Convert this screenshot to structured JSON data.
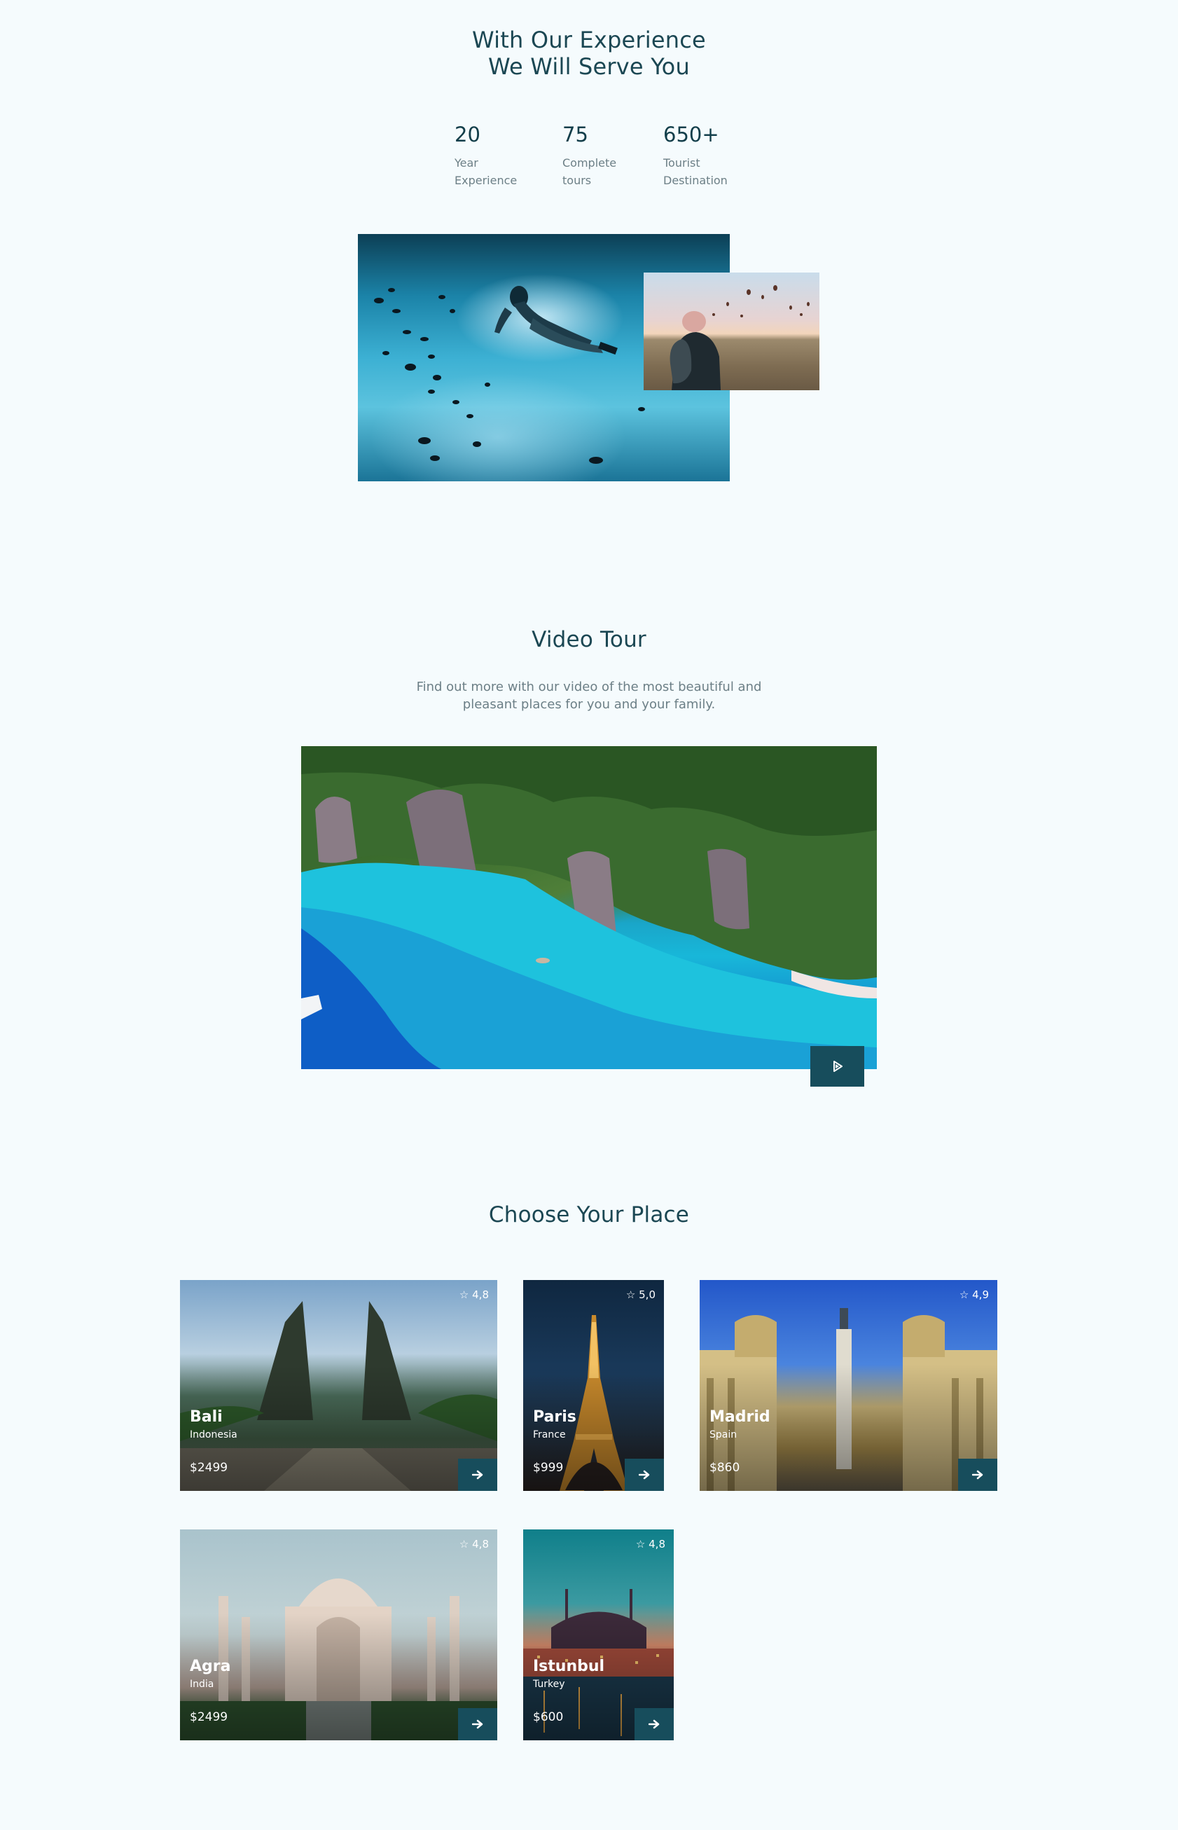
{
  "experience": {
    "title_line1": "With Our Experience",
    "title_line2": "We Will Serve You",
    "stats": [
      {
        "value": "20",
        "label_line1": "Year",
        "label_line2": "Experience"
      },
      {
        "value": "75",
        "label_line1": "Complete",
        "label_line2": "tours"
      },
      {
        "value": "650+",
        "label_line1": "Tourist",
        "label_line2": "Destination"
      }
    ]
  },
  "video": {
    "title": "Video Tour",
    "desc_line1": "Find out more with our video of the most beautiful and",
    "desc_line2": "pleasant places for you and your family.",
    "play_icon": "play-icon"
  },
  "places": {
    "title": "Choose Your Place",
    "items": [
      {
        "city": "Bali",
        "country": "Indonesia",
        "price": "$2499",
        "rating": "4,8"
      },
      {
        "city": "Paris",
        "country": "France",
        "price": "$999",
        "rating": "5,0"
      },
      {
        "city": "Madrid",
        "country": "Spain",
        "price": "$860",
        "rating": "4,9"
      },
      {
        "city": "Agra",
        "country": "India",
        "price": "$2499",
        "rating": "4,8"
      },
      {
        "city": "Istunbul",
        "country": "Turkey",
        "price": "$600",
        "rating": "4,8"
      }
    ],
    "arrow_icon": "arrow-right-icon",
    "star_icon": "star-icon"
  },
  "colors": {
    "background": "#f5fbfd",
    "heading": "#1b4753",
    "accent": "#174d5c",
    "muted_text": "#6c7f86"
  }
}
